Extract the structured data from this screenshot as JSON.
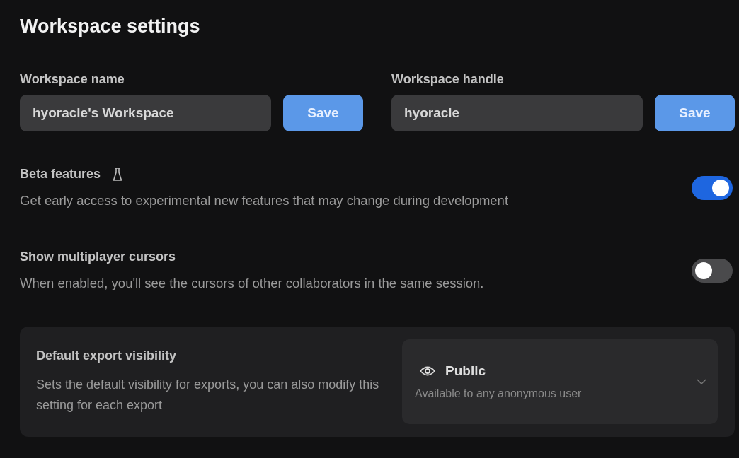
{
  "title": "Workspace settings",
  "fields": [
    {
      "label": "Workspace name",
      "value": "hyoracle's Workspace",
      "button": "Save"
    },
    {
      "label": "Workspace handle",
      "value": "hyoracle",
      "button": "Save"
    }
  ],
  "toggles": [
    {
      "title": "Beta features",
      "description": "Get early access to experimental new features that may change during development",
      "on": true,
      "flask": true
    },
    {
      "title": "Show multiplayer cursors",
      "description": "When enabled, you'll see the cursors of other collaborators in the same session.",
      "on": false,
      "flask": false
    }
  ],
  "export_visibility": {
    "title": "Default export visibility",
    "description": "Sets the default visibility for exports, you can also modify this setting for each export",
    "value": "Public",
    "value_description": "Available to any anonymous user"
  }
}
